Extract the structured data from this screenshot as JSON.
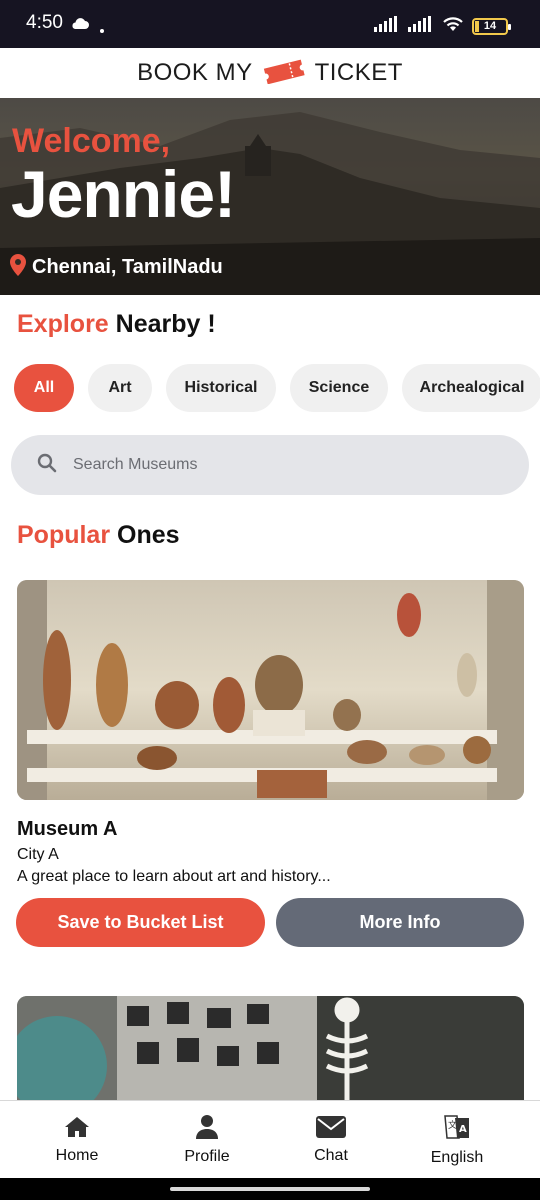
{
  "status_bar": {
    "time": "4:50",
    "battery": "14"
  },
  "header": {
    "brand_left": "BOOK MY",
    "brand_right": "TICKET",
    "brand_icon": "ticket-icon",
    "brand_color": "#e8523f"
  },
  "hero": {
    "welcome": "Welcome,",
    "username": "Jennie!",
    "location": "Chennai, TamilNadu",
    "location_icon": "map-pin-icon"
  },
  "explore": {
    "accent": "Explore",
    "rest": "Nearby !",
    "chips": [
      {
        "label": "All",
        "active": true
      },
      {
        "label": "Art",
        "active": false
      },
      {
        "label": "Historical",
        "active": false
      },
      {
        "label": "Science",
        "active": false
      },
      {
        "label": "Archealogical",
        "active": false
      }
    ]
  },
  "search": {
    "placeholder": "Search Museums",
    "icon": "search-icon"
  },
  "popular": {
    "accent": "Popular",
    "rest": "Ones",
    "cards": [
      {
        "title": "Museum A",
        "city": "City A",
        "description": "A great place to learn about art and history...",
        "save_label": "Save to Bucket List",
        "info_label": "More Info"
      }
    ]
  },
  "bottom_nav": [
    {
      "label": "Home",
      "icon": "home-icon"
    },
    {
      "label": "Profile",
      "icon": "user-icon"
    },
    {
      "label": "Chat",
      "icon": "envelope-icon"
    },
    {
      "label": "English",
      "icon": "translate-icon"
    }
  ],
  "colors": {
    "accent": "#e8523f",
    "secondary_button": "#646a77",
    "search_bg": "#e4e5e9",
    "chip_bg": "#f0f0f0"
  }
}
